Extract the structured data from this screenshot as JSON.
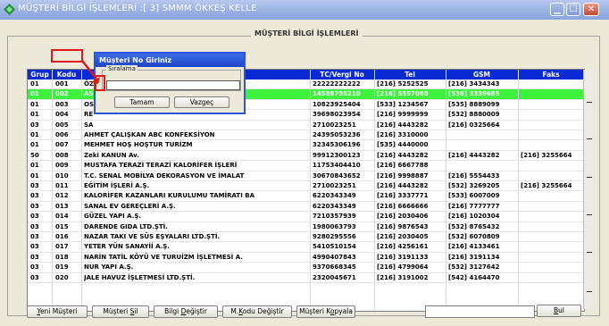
{
  "window": {
    "title": "MÜŞTERİ BİLGİ İŞLEMLERİ :[ 3] SMMM ÖKKEŞ KELLE"
  },
  "group": {
    "title": "MÜŞTERİ BİLGİ İŞLEMLERİ"
  },
  "columns": {
    "grup": "Grup",
    "kodu": "Kodu",
    "unvan": "",
    "vergi": "TC/Vergi No",
    "tel": "Tel",
    "gsm": "GSM",
    "faks": "Faks"
  },
  "rows": [
    {
      "grup": "01",
      "kodu": "001",
      "unvan": "ÖZ",
      "vergi": "22222222222",
      "tel": "[216] 5252525",
      "gsm": "[216] 3434343",
      "faks": ""
    },
    {
      "grup": "01",
      "kodu": "002",
      "unvan": "AS                                                                    IK",
      "vergi": "14588795210",
      "tel": "[216] 5557080",
      "gsm": "[536] 3339685",
      "faks": ""
    },
    {
      "grup": "01",
      "kodu": "003",
      "unvan": "OS",
      "vergi": "10823925404",
      "tel": "[533] 1234567",
      "gsm": "[535] 8889099",
      "faks": ""
    },
    {
      "grup": "01",
      "kodu": "004",
      "unvan": "RE",
      "vergi": "39698023954",
      "tel": "[216] 9999999",
      "gsm": "[532] 8880009",
      "faks": ""
    },
    {
      "grup": "03",
      "kodu": "005",
      "unvan": "SA",
      "vergi": "2710023251",
      "tel": "[216] 4443282",
      "gsm": "[216] 0325664",
      "faks": ""
    },
    {
      "grup": "01",
      "kodu": "006",
      "unvan": "AHMET ÇALIŞKAN ABC KONFEKSİYON",
      "vergi": "24395053236",
      "tel": "[216] 3310000",
      "gsm": "",
      "faks": ""
    },
    {
      "grup": "01",
      "kodu": "007",
      "unvan": "MEHMET HOŞ HOŞTUR TURİZM",
      "vergi": "32345306196",
      "tel": "[535] 4440000",
      "gsm": "",
      "faks": ""
    },
    {
      "grup": "50",
      "kodu": "008",
      "unvan": "Zeki KANUN Av.",
      "vergi": "99912300123",
      "tel": "[216] 4443282",
      "gsm": "[216] 4443282",
      "faks": "[216] 3255664"
    },
    {
      "grup": "01",
      "kodu": "009",
      "unvan": "MUSTAFA TERAZİ TERAZİ KALORİFER İŞLERİ",
      "vergi": "11753404410",
      "tel": "[216] 6667788",
      "gsm": "",
      "faks": ""
    },
    {
      "grup": "01",
      "kodu": "010",
      "unvan": "  T.C. SENAL MOBİLYA DEKORASYON VE İMALAT",
      "vergi": "30670843652",
      "tel": "[216] 9998887",
      "gsm": "[216] 5554433",
      "faks": ""
    },
    {
      "grup": "03",
      "kodu": "011",
      "unvan": "EĞİTİM İŞLERİ A.Ş.",
      "vergi": "2710023251",
      "tel": "[216] 4443282",
      "gsm": "[532] 3269205",
      "faks": "[216] 3255664"
    },
    {
      "grup": "03",
      "kodu": "012",
      "unvan": "KALORİFER KAZANLARI KURULUMU TAMİRATI BA",
      "vergi": "6220343349",
      "tel": "[216] 3337771",
      "gsm": "[533] 6007009",
      "faks": ""
    },
    {
      "grup": "03",
      "kodu": "013",
      "unvan": "SANAL EV GEREÇLERİ A.Ş.",
      "vergi": "6220343349",
      "tel": "[216] 6666666",
      "gsm": "[216] 7777777",
      "faks": ""
    },
    {
      "grup": "03",
      "kodu": "014",
      "unvan": "GÜZEL YAPI A.Ş.",
      "vergi": "7210357939",
      "tel": "[216] 2030406",
      "gsm": "[216] 1020304",
      "faks": ""
    },
    {
      "grup": "03",
      "kodu": "015",
      "unvan": "DARENDE GIDA LTD.ŞTİ.",
      "vergi": "1980063793",
      "tel": "[216] 9876543",
      "gsm": "[532] 8765432",
      "faks": ""
    },
    {
      "grup": "03",
      "kodu": "016",
      "unvan": "NAZAR TAKI VE SÜS EŞYALARI LTD.ŞTİ.",
      "vergi": "9280295556",
      "tel": "[216] 2030405",
      "gsm": "[532] 6070809",
      "faks": ""
    },
    {
      "grup": "03",
      "kodu": "017",
      "unvan": "YETER YÜN SANAYİİ A.Ş.",
      "vergi": "5410510154",
      "tel": "[216] 4256161",
      "gsm": "[216] 4133461",
      "faks": ""
    },
    {
      "grup": "03",
      "kodu": "018",
      "unvan": "NARİN TATİL KÖYÜ VE TURUİZM İŞLETMESİ A.",
      "vergi": "4990407843",
      "tel": "[216] 3191133",
      "gsm": "[216] 3191134",
      "faks": ""
    },
    {
      "grup": "03",
      "kodu": "019",
      "unvan": "NUR YAPI A.Ş.",
      "vergi": "9370668345",
      "tel": "[216] 4799064",
      "gsm": "[532] 3127642",
      "faks": ""
    },
    {
      "grup": "03",
      "kodu": "020",
      "unvan": "JALE HAVUZ İŞLETMESİ LTD.ŞTİ.",
      "vergi": "2320045671",
      "tel": "[216] 3191002",
      "gsm": "[542] 4164470",
      "faks": ""
    }
  ],
  "selected_row_index": 1,
  "buttons": {
    "yeni": {
      "key": "Y",
      "rest": "eni Müşteri"
    },
    "sil": {
      "pre": "Müşteri ",
      "key": "S",
      "rest": "il"
    },
    "bilgi": {
      "pre": "Bilgi ",
      "key": "D",
      "rest": "eğiştir"
    },
    "kodu": {
      "pre": "M.",
      "key": "K",
      "rest": "odu Değiştir"
    },
    "kopyala": {
      "pre": "Müşteri K",
      "key": "o",
      "rest": "pyala"
    },
    "bul": {
      "key": "B",
      "rest": "ul"
    }
  },
  "dialog": {
    "title": "Müşteri No Giriniz",
    "frame_label": "Sıralama",
    "ok": "Tamam",
    "cancel": "Vazgeç"
  },
  "colors": {
    "header": "#0a2bd4",
    "selected_row": "#3df13d",
    "highlight": "#e11818"
  }
}
